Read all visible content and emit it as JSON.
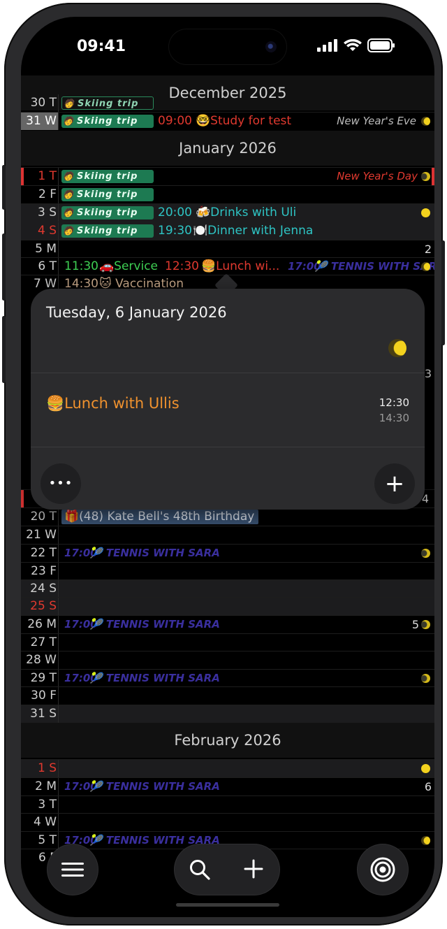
{
  "status": {
    "time": "09:41"
  },
  "months": [
    {
      "label": "December 2025"
    },
    {
      "label": "January 2026"
    },
    {
      "label": "February 2026"
    }
  ],
  "days": {
    "d30": {
      "label": "30 T"
    },
    "d31": {
      "label": "31 W",
      "time": "09:00",
      "title": "🤓Study for test",
      "holiday": "New Year's Eve"
    },
    "j1": {
      "label": "1 T",
      "holiday": "New Year's Day"
    },
    "j2": {
      "label": "2 F"
    },
    "j3": {
      "label": "3 S",
      "time": "20:00",
      "title": "🍻Drinks with Uli"
    },
    "j4": {
      "label": "4 S",
      "time": "19:30",
      "title": "🍽️Dinner with Jenna"
    },
    "j5": {
      "label": "5 M",
      "week": "2"
    },
    "j6": {
      "label": "6 T",
      "t1": "11:30",
      "e1": "🚗Service",
      "t2": "12:30",
      "e2": "🍔Lunch wi...",
      "t3": "17:00",
      "e3": "🎾 TENNIS WITH SARA"
    },
    "j7": {
      "label": "7 W",
      "time": "14:30",
      "title": "🐱 Vaccination"
    },
    "j20": {
      "label": "20 T",
      "title": "🎁(48) Kate Bell's 48th Birthday"
    },
    "j21": {
      "label": "21 W"
    },
    "j22": {
      "label": "22 T",
      "time": "17:00",
      "title": "🎾 TENNIS WITH SARA"
    },
    "j23": {
      "label": "23 F"
    },
    "j24": {
      "label": "24 S"
    },
    "j25": {
      "label": "25 S"
    },
    "j26": {
      "label": "26 M",
      "time": "17:00",
      "title": "🎾 TENNIS WITH SARA",
      "week": "5"
    },
    "j27": {
      "label": "27 T"
    },
    "j28": {
      "label": "28 W"
    },
    "j29": {
      "label": "29 T",
      "time": "17:00",
      "title": "🎾 TENNIS WITH SARA"
    },
    "j30": {
      "label": "30 F"
    },
    "j31": {
      "label": "31 S"
    },
    "f1": {
      "label": "1 S"
    },
    "f2": {
      "label": "2 M",
      "time": "17:00",
      "title": "🎾 TENNIS WITH SARA",
      "week": "6"
    },
    "f3": {
      "label": "3 T"
    },
    "f4": {
      "label": "4 W"
    },
    "f5": {
      "label": "5 T",
      "time": "17:00",
      "title": "🎾 TENNIS WITH SARA"
    },
    "f6": {
      "label": "6 F"
    }
  },
  "skiing_label": "Skiing trip",
  "side_numbers": {
    "n3": "3",
    "n4": "4"
  },
  "popup": {
    "date": "Tuesday, 6 January 2026",
    "event_title": "🍔Lunch with Ullis",
    "start": "12:30",
    "end": "14:30",
    "more_icon": "•••",
    "add_icon": "+"
  },
  "toolbar": {
    "menu_icon": "menu-icon",
    "search_icon": "search-icon",
    "add_icon": "plus-icon",
    "target_icon": "target-icon"
  },
  "colors": {
    "ski": "#1d7a52",
    "tennis": "#3a2f9e",
    "red": "#e0392f",
    "orange": "#f0922e",
    "teal": "#2ec5c5",
    "green": "#3ecf53"
  }
}
